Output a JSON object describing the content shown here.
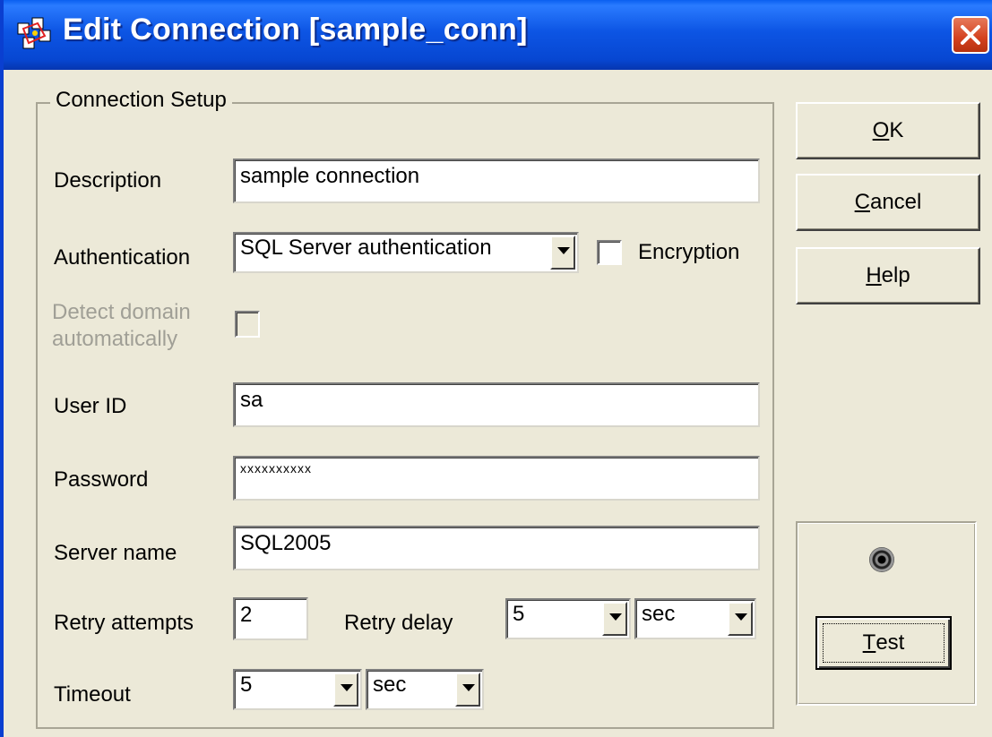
{
  "window": {
    "title": "Edit Connection [sample_conn]",
    "app_icon": "connection-app-icon",
    "close_icon": "close-icon"
  },
  "group": {
    "title": "Connection Setup"
  },
  "fields": {
    "description": {
      "label": "Description",
      "value": "sample connection"
    },
    "authentication": {
      "label": "Authentication",
      "value": "SQL Server authentication"
    },
    "encryption": {
      "label": "Encryption",
      "checked": false
    },
    "detect_domain": {
      "label": "Detect domain automatically",
      "checked": false,
      "disabled": true
    },
    "user_id": {
      "label": "User ID",
      "value": "sa"
    },
    "password": {
      "label": "Password",
      "value": "xxxxxxxxxx"
    },
    "server_name": {
      "label": "Server name",
      "value": "SQL2005"
    },
    "retry_attempts": {
      "label": "Retry attempts",
      "value": "2"
    },
    "retry_delay": {
      "label": "Retry delay",
      "value": "5",
      "unit": "sec"
    },
    "timeout": {
      "label": "Timeout",
      "value": "5",
      "unit": "sec"
    }
  },
  "buttons": {
    "ok": {
      "mnemonic": "O",
      "rest": "K"
    },
    "cancel": {
      "mnemonic": "C",
      "rest": "ancel"
    },
    "help": {
      "mnemonic": "H",
      "rest": "elp"
    },
    "test": {
      "mnemonic": "T",
      "rest": "est"
    }
  },
  "status_indicator": "status-light-icon",
  "colors": {
    "titlebar": "#0d55e4",
    "dialog_bg": "#ece9d8",
    "close": "#d3411f"
  }
}
